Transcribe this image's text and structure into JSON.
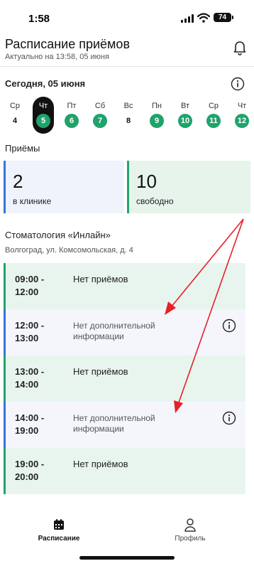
{
  "status_bar": {
    "time": "1:58",
    "battery": "74"
  },
  "header": {
    "title": "Расписание приёмов",
    "subtitle": "Актуально на 13:58, 05 июня",
    "bell_icon": "bell-icon"
  },
  "today": {
    "label": "Сегодня, 05 июня",
    "info_icon": "info-icon"
  },
  "days": [
    {
      "weekday": "Ср",
      "num": "4"
    },
    {
      "weekday": "Чт",
      "num": "5"
    },
    {
      "weekday": "Пт",
      "num": "6"
    },
    {
      "weekday": "Сб",
      "num": "7"
    },
    {
      "weekday": "Вс",
      "num": "8"
    },
    {
      "weekday": "Пн",
      "num": "9"
    },
    {
      "weekday": "Вт",
      "num": "10"
    },
    {
      "weekday": "Ср",
      "num": "11"
    },
    {
      "weekday": "Чт",
      "num": "12"
    }
  ],
  "appointments": {
    "label": "Приёмы",
    "in_clinic": {
      "count": "2",
      "label": "в клинике"
    },
    "free": {
      "count": "10",
      "label": "свободно"
    }
  },
  "clinic": {
    "name": "Стоматология «Инлайн»",
    "address": "Волгоград, ул. Комсомольская, д. 4"
  },
  "slots": [
    {
      "start": "09:00 -",
      "end": "12:00",
      "text": "Нет приёмов"
    },
    {
      "start": "12:00 -",
      "end": "13:00",
      "text": "Нет дополнительной информации"
    },
    {
      "start": "13:00 -",
      "end": "14:00",
      "text": "Нет приёмов"
    },
    {
      "start": "14:00 -",
      "end": "19:00",
      "text": "Нет дополнительной информации"
    },
    {
      "start": "19:00 -",
      "end": "20:00",
      "text": "Нет приёмов"
    }
  ],
  "bottom_nav": {
    "schedule": "Расписание",
    "profile": "Профиль"
  },
  "colors": {
    "green": "#1fa36b",
    "blue": "#3b73d9",
    "arrow_red": "#e8202a"
  }
}
